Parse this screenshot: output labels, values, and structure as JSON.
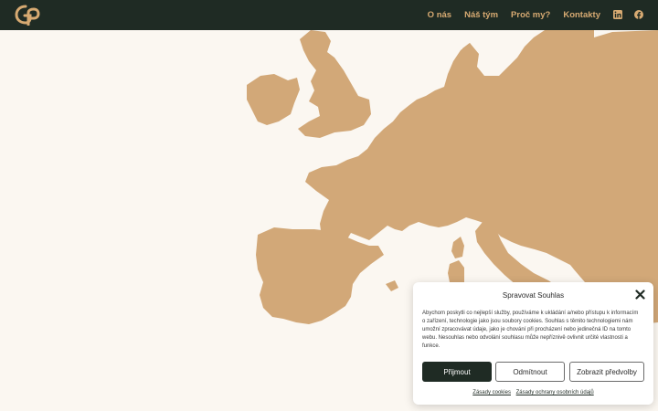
{
  "colors": {
    "nav_bg": "#1f2b24",
    "accent": "#d7aa72",
    "map": "#d2a878",
    "page_bg": "#fbf7f1"
  },
  "header": {
    "logo_icon": "gp-logo-icon",
    "nav": [
      {
        "label": "O nás"
      },
      {
        "label": "Náš tým"
      },
      {
        "label": "Proč my?"
      },
      {
        "label": "Kontakty"
      }
    ],
    "social": [
      "linkedin-icon",
      "facebook-icon"
    ]
  },
  "cookie": {
    "title": "Spravovat Souhlas",
    "text": "Abychom poskytli co nejlepší služby, používáme k ukládání a/nebo přístupu k informacím o zařízení, technologie jako jsou soubory cookies. Souhlas s těmito technologiemi nám umožní zpracovávat údaje, jako je chování při procházení nebo jedinečná ID na tomto webu. Nesouhlas nebo odvolání souhlasu může nepříznivě ovlivnit určité vlastnosti a funkce.",
    "accept": "Přijmout",
    "deny": "Odmítnout",
    "preferences": "Zobrazit předvolby",
    "links": [
      "Zásady cookies",
      "Zásady ochrany osobních údajů"
    ]
  }
}
